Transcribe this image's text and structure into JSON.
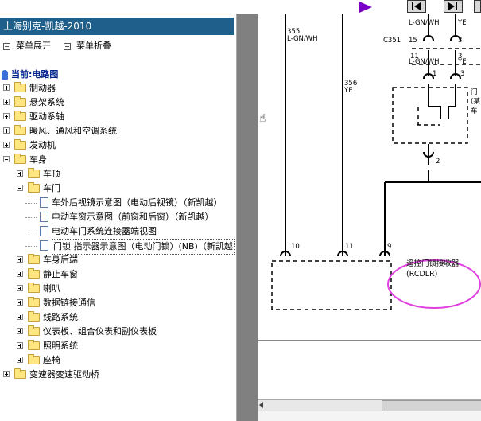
{
  "app_title": "上海别克-凯越-2010",
  "menu": {
    "expand_label": "菜单展开",
    "collapse_label": "菜单折叠"
  },
  "current": "当前:电路图",
  "tree": [
    {
      "label": "制动器",
      "level": 0,
      "expander": "plus",
      "kind": "folder"
    },
    {
      "label": "悬架系统",
      "level": 0,
      "expander": "plus",
      "kind": "folder"
    },
    {
      "label": "驱动系轴",
      "level": 0,
      "expander": "plus",
      "kind": "folder"
    },
    {
      "label": "暖风、通风和空调系统",
      "level": 0,
      "expander": "plus",
      "kind": "folder"
    },
    {
      "label": "发动机",
      "level": 0,
      "expander": "plus",
      "kind": "folder"
    },
    {
      "label": "车身",
      "level": 0,
      "expander": "minus",
      "kind": "folder"
    },
    {
      "label": "车顶",
      "level": 1,
      "expander": "plus",
      "kind": "folder"
    },
    {
      "label": "车门",
      "level": 1,
      "expander": "minus",
      "kind": "folder"
    },
    {
      "label": "车外后视镜示意图（电动后视镜）（新凯越）",
      "level": 2,
      "expander": "none",
      "kind": "doc"
    },
    {
      "label": "电动车窗示意图（前窗和后窗）（新凯越）",
      "level": 2,
      "expander": "none",
      "kind": "doc"
    },
    {
      "label": "电动车门系统连接器端视图",
      "level": 2,
      "expander": "none",
      "kind": "doc"
    },
    {
      "label": "门锁 指示器示意图（电动门锁）(NB)（新凯越",
      "level": 2,
      "expander": "none",
      "kind": "doc",
      "selected": true
    },
    {
      "label": "车身后端",
      "level": 1,
      "expander": "plus",
      "kind": "folder"
    },
    {
      "label": "静止车窗",
      "level": 1,
      "expander": "plus",
      "kind": "folder"
    },
    {
      "label": "喇叭",
      "level": 1,
      "expander": "plus",
      "kind": "folder"
    },
    {
      "label": "数据链接通信",
      "level": 1,
      "expander": "plus",
      "kind": "folder"
    },
    {
      "label": "线路系统",
      "level": 1,
      "expander": "plus",
      "kind": "folder"
    },
    {
      "label": "仪表板、组合仪表和副仪表板",
      "level": 1,
      "expander": "plus",
      "kind": "folder"
    },
    {
      "label": "照明系统",
      "level": 1,
      "expander": "plus",
      "kind": "folder"
    },
    {
      "label": "座椅",
      "level": 1,
      "expander": "plus",
      "kind": "folder"
    },
    {
      "label": "变速器变速驱动桥",
      "level": 0,
      "expander": "plus",
      "kind": "folder"
    }
  ],
  "diagram": {
    "wire1_num": "355",
    "wire1_color": "L-GN/WH",
    "wire2_num": "356",
    "wire2_color": "YE",
    "top_right_color": "L-GN/WH",
    "top_right_yel": "YE",
    "pin15": "15",
    "pin3a": "3",
    "connector": "C351",
    "pin11": "11",
    "pin3b": "3",
    "mid_color": "L-GN/WH",
    "mid_yel": "YE",
    "pin1": "1",
    "pin3c": "3",
    "door_label_1": "门",
    "door_label_2": "(某",
    "door_label_3": "车",
    "pin2": "2",
    "pin10": "10",
    "pin11b": "11",
    "pin9": "9",
    "receiver_label": "遥控门锁接收器",
    "receiver_code": "(RCDLR)",
    "highlight_color": "#e040e0"
  }
}
